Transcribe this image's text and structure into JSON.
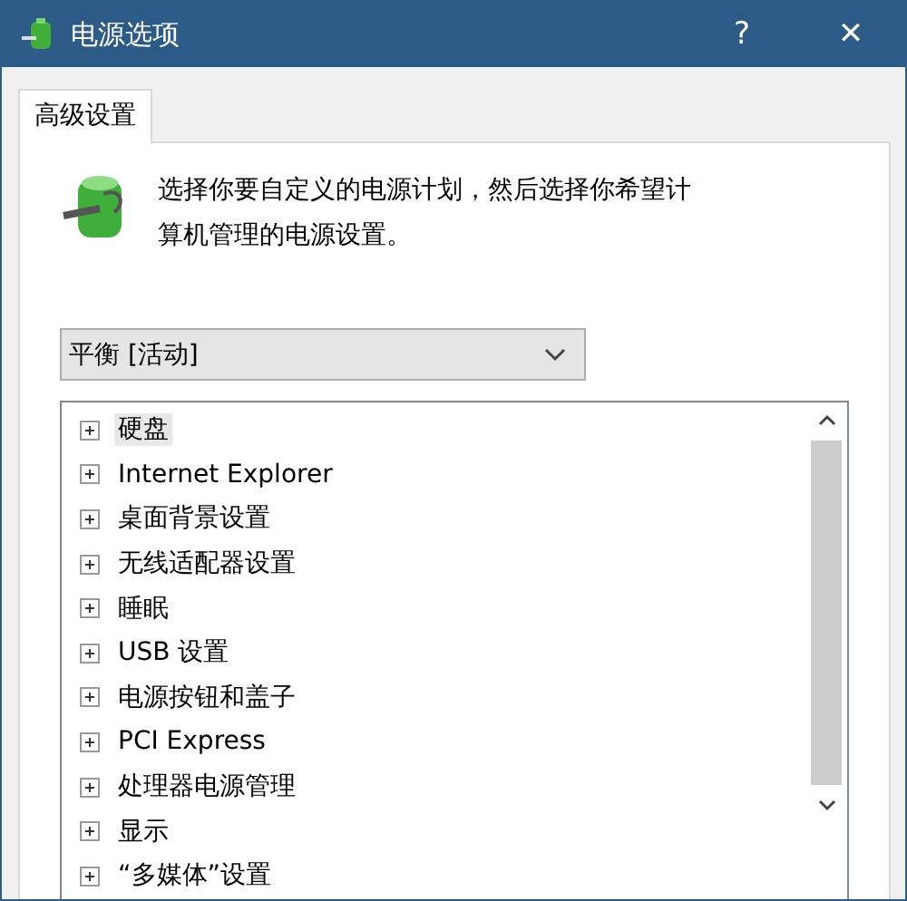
{
  "window": {
    "title": "电源选项",
    "help": "?",
    "close": "✕"
  },
  "tabs": [
    {
      "label": "高级设置",
      "selected": true
    }
  ],
  "description": "选择你要自定义的电源计划，然后选择你希望计算机管理的电源设置。",
  "plan_dropdown": {
    "value": "平衡 [活动]"
  },
  "settings_tree": [
    {
      "label": "硬盘",
      "expanded": false,
      "selected": true
    },
    {
      "label": "Internet Explorer",
      "expanded": false,
      "selected": false
    },
    {
      "label": "桌面背景设置",
      "expanded": false,
      "selected": false
    },
    {
      "label": "无线适配器设置",
      "expanded": false,
      "selected": false
    },
    {
      "label": "睡眠",
      "expanded": false,
      "selected": false
    },
    {
      "label": "USB 设置",
      "expanded": false,
      "selected": false
    },
    {
      "label": "电源按钮和盖子",
      "expanded": false,
      "selected": false
    },
    {
      "label": "PCI Express",
      "expanded": false,
      "selected": false
    },
    {
      "label": "处理器电源管理",
      "expanded": false,
      "selected": false
    },
    {
      "label": "显示",
      "expanded": false,
      "selected": false
    },
    {
      "label": "“多媒体”设置",
      "expanded": false,
      "selected": false
    }
  ]
}
